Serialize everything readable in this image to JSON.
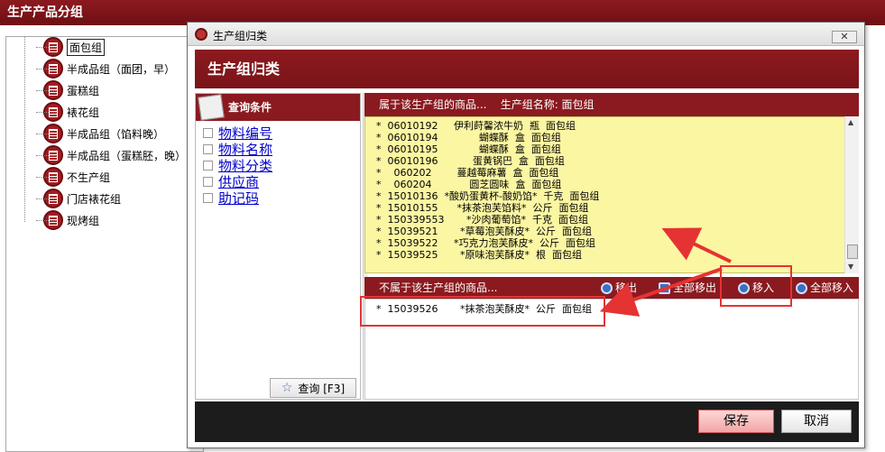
{
  "app": {
    "title": "生产产品分组"
  },
  "tree": {
    "items": [
      {
        "label": "面包组",
        "selected": true
      },
      {
        "label": "半成品组（面团，早）"
      },
      {
        "label": "蛋糕组"
      },
      {
        "label": "裱花组"
      },
      {
        "label": "半成品组（馅料晚）"
      },
      {
        "label": "半成品组（蛋糕胚，晚）"
      },
      {
        "label": "不生产组"
      },
      {
        "label": "门店裱花组"
      },
      {
        "label": "现烤组"
      }
    ]
  },
  "dialog": {
    "window_title": "生产组归类",
    "header_title": "生产组归类",
    "close_label": "✕",
    "query": {
      "title": "查询条件",
      "fields": [
        "物料编号",
        "物料名称",
        "物料分类",
        "供应商",
        "助记码"
      ],
      "button_label": "查询 [F3]"
    },
    "in_group": {
      "header": "属于该生产组的商品...    生产组名称: 面包组",
      "records": [
        "*  06010192     伊利莳馨浓牛奶  瓶  面包组",
        "*  06010194             蝴蝶酥  盒  面包组",
        "*  06010195             蝴蝶酥  盒  面包组",
        "*  06010196           蛋黄锅巴  盒  面包组",
        "*    060202        蔓越莓麻薯  盒  面包组",
        "*    060204            圆芝圆味  盒  面包组",
        "*  15010136  *酸奶蛋黄杯-酸奶馅*  千克  面包组",
        "*  15010155      *抹茶泡芙馅料*  公斤  面包组",
        "*  150339553       *沙肉葡萄馅*  千克  面包组",
        "*  15039521       *草莓泡芙酥皮*  公斤  面包组",
        "*  15039522     *巧克力泡芙酥皮*  公斤  面包组",
        "*  15039525       *原味泡芙酥皮*  根  面包组"
      ]
    },
    "out_group": {
      "header": "不属于该生产组的商品...",
      "remove_label": "移出",
      "remove_all_label": "全部移出",
      "add_label": "移入",
      "add_all_label": "全部移入",
      "records": [
        "*  15039526       *抹茶泡芙酥皮*  公斤  面包组"
      ]
    },
    "save_label": "保存",
    "cancel_label": "取消"
  }
}
